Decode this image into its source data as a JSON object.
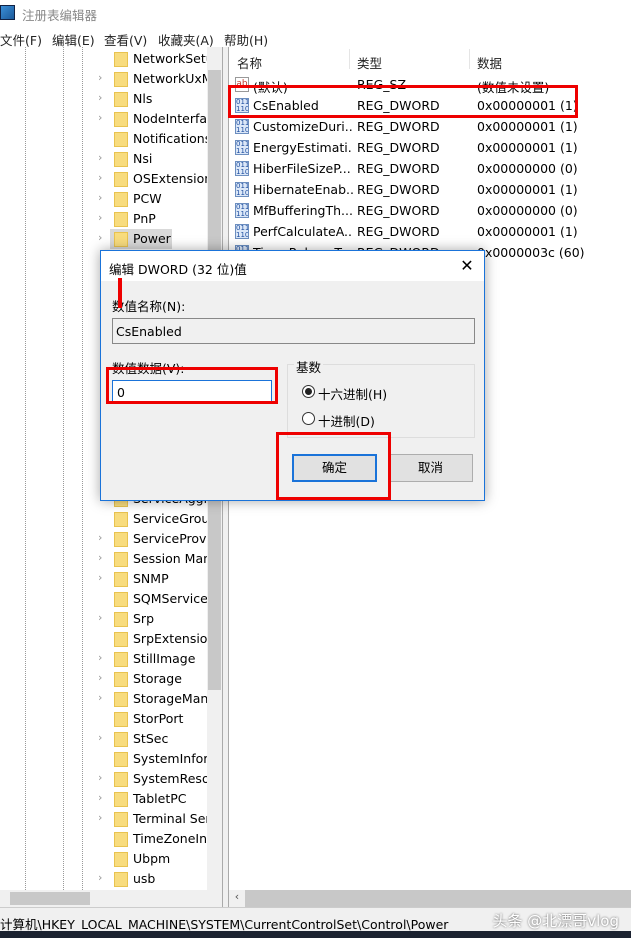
{
  "window": {
    "title": "注册表编辑器",
    "icon": "registry-icon"
  },
  "menu": [
    "文件(F)",
    "编辑(E)",
    "查看(V)",
    "收藏夹(A)",
    "帮助(H)"
  ],
  "tree": {
    "top_items": [
      {
        "label": "NetworkSetu",
        "expandable": false
      },
      {
        "label": "NetworkUxM",
        "expandable": true
      },
      {
        "label": "Nls",
        "expandable": true
      },
      {
        "label": "NodeInterfac",
        "expandable": true
      },
      {
        "label": "Notifications",
        "expandable": false
      },
      {
        "label": "Nsi",
        "expandable": true
      },
      {
        "label": "OSExtension",
        "expandable": true
      },
      {
        "label": "PCW",
        "expandable": true
      },
      {
        "label": "PnP",
        "expandable": true
      },
      {
        "label": "Power",
        "expandable": true,
        "selected": true
      }
    ],
    "bottom_items": [
      {
        "label": "ServiceAggr",
        "expandable": false
      },
      {
        "label": "ServiceGroup",
        "expandable": false
      },
      {
        "label": "ServiceProvid",
        "expandable": true
      },
      {
        "label": "Session Man",
        "expandable": true
      },
      {
        "label": "SNMP",
        "expandable": true
      },
      {
        "label": "SQMServiceL",
        "expandable": false
      },
      {
        "label": "Srp",
        "expandable": true
      },
      {
        "label": "SrpExtension",
        "expandable": false
      },
      {
        "label": "StillImage",
        "expandable": true
      },
      {
        "label": "Storage",
        "expandable": true
      },
      {
        "label": "StorageMan",
        "expandable": true
      },
      {
        "label": "StorPort",
        "expandable": false
      },
      {
        "label": "StSec",
        "expandable": true
      },
      {
        "label": "SystemInforr",
        "expandable": false
      },
      {
        "label": "SystemResou",
        "expandable": true
      },
      {
        "label": "TabletPC",
        "expandable": true
      },
      {
        "label": "Terminal Ser",
        "expandable": true
      },
      {
        "label": "TimeZoneInf",
        "expandable": false
      },
      {
        "label": "Ubpm",
        "expandable": false
      },
      {
        "label": "usb",
        "expandable": true
      }
    ]
  },
  "list": {
    "headers": [
      "名称",
      "类型",
      "数据"
    ],
    "rows": [
      {
        "name": "(默认)",
        "type": "REG_SZ",
        "data": "(数值未设置)",
        "icon": "string-value-icon"
      },
      {
        "name": "CsEnabled",
        "type": "REG_DWORD",
        "data": "0x00000001 (1)",
        "icon": "dword-value-icon",
        "highlighted": true
      },
      {
        "name": "CustomizeDuri...",
        "type": "REG_DWORD",
        "data": "0x00000001 (1)",
        "icon": "dword-value-icon"
      },
      {
        "name": "EnergyEstimati...",
        "type": "REG_DWORD",
        "data": "0x00000001 (1)",
        "icon": "dword-value-icon"
      },
      {
        "name": "HiberFileSizeP...",
        "type": "REG_DWORD",
        "data": "0x00000000 (0)",
        "icon": "dword-value-icon"
      },
      {
        "name": "HibernateEnab...",
        "type": "REG_DWORD",
        "data": "0x00000001 (1)",
        "icon": "dword-value-icon"
      },
      {
        "name": "MfBufferingTh...",
        "type": "REG_DWORD",
        "data": "0x00000000 (0)",
        "icon": "dword-value-icon"
      },
      {
        "name": "PerfCalculateA...",
        "type": "REG_DWORD",
        "data": "0x00000001 (1)",
        "icon": "dword-value-icon"
      },
      {
        "name": "TimerRebaseT...",
        "type": "REG_DWORD",
        "data": "0x0000003c (60)",
        "icon": "dword-value-icon"
      }
    ]
  },
  "dialog": {
    "title": "编辑 DWORD (32 位)值",
    "name_label": "数值名称(N):",
    "name_value": "CsEnabled",
    "data_label": "数值数据(V):",
    "data_value": "0",
    "base_label": "基数",
    "radio_hex": "十六进制(H)",
    "radio_dec": "十进制(D)",
    "selected_base": "hex",
    "ok": "确定",
    "cancel": "取消"
  },
  "status": {
    "path": "计算机\\HKEY_LOCAL_MACHINE\\SYSTEM\\CurrentControlSet\\Control\\Power"
  },
  "watermark": "头条 @北漂哥vlog",
  "colors": {
    "highlight": "#e00000",
    "accent": "#1a73d9",
    "folder": "#f8dc7e"
  }
}
